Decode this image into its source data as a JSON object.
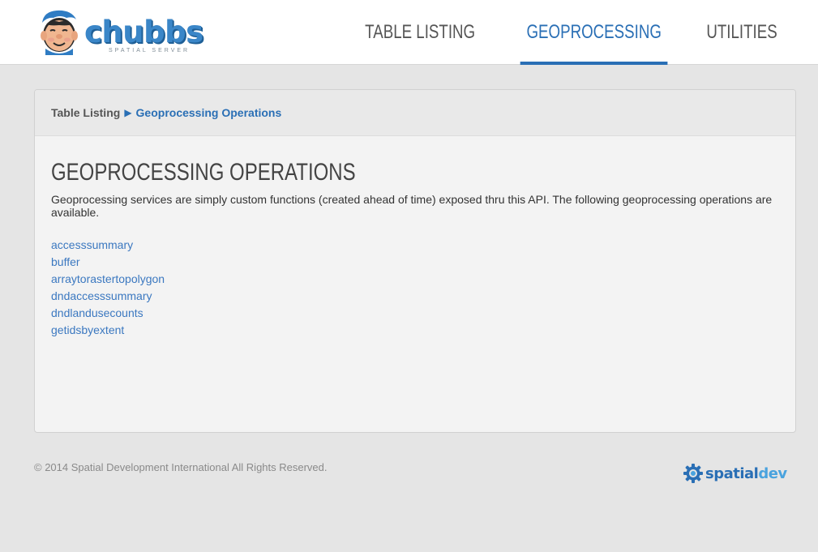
{
  "brand": {
    "name": "chubbs",
    "tagline": "SPATIAL SERVER"
  },
  "nav": {
    "items": [
      {
        "label": "TABLE LISTING",
        "active": false
      },
      {
        "label": "GEOPROCESSING",
        "active": true
      },
      {
        "label": "UTILITIES",
        "active": false
      }
    ]
  },
  "breadcrumb": {
    "root": "Table Listing",
    "separator": "▶",
    "current": "Geoprocessing Operations"
  },
  "main": {
    "title": "GEOPROCESSING OPERATIONS",
    "description": "Geoprocessing services are simply custom functions (created ahead of time) exposed thru this API. The following geoprocessing operations are available.",
    "operations": [
      "accesssummary",
      "buffer",
      "arraytorastertopolygon",
      "dndaccesssummary",
      "dndlandusecounts",
      "getidsbyextent"
    ]
  },
  "footer": {
    "copyright": "© 2014 Spatial Development International All Rights Reserved.",
    "logo_part1": "spatial",
    "logo_part2": "dev"
  },
  "colors": {
    "accent": "#2a6fb5",
    "link": "#3b78c0",
    "background": "#e5e5e5",
    "panel": "#f3f3f3"
  },
  "icons": {
    "brand_logo": "mascot-face-icon",
    "breadcrumb_separator": "triangle-right-icon",
    "footer_logo": "gear-icon"
  }
}
